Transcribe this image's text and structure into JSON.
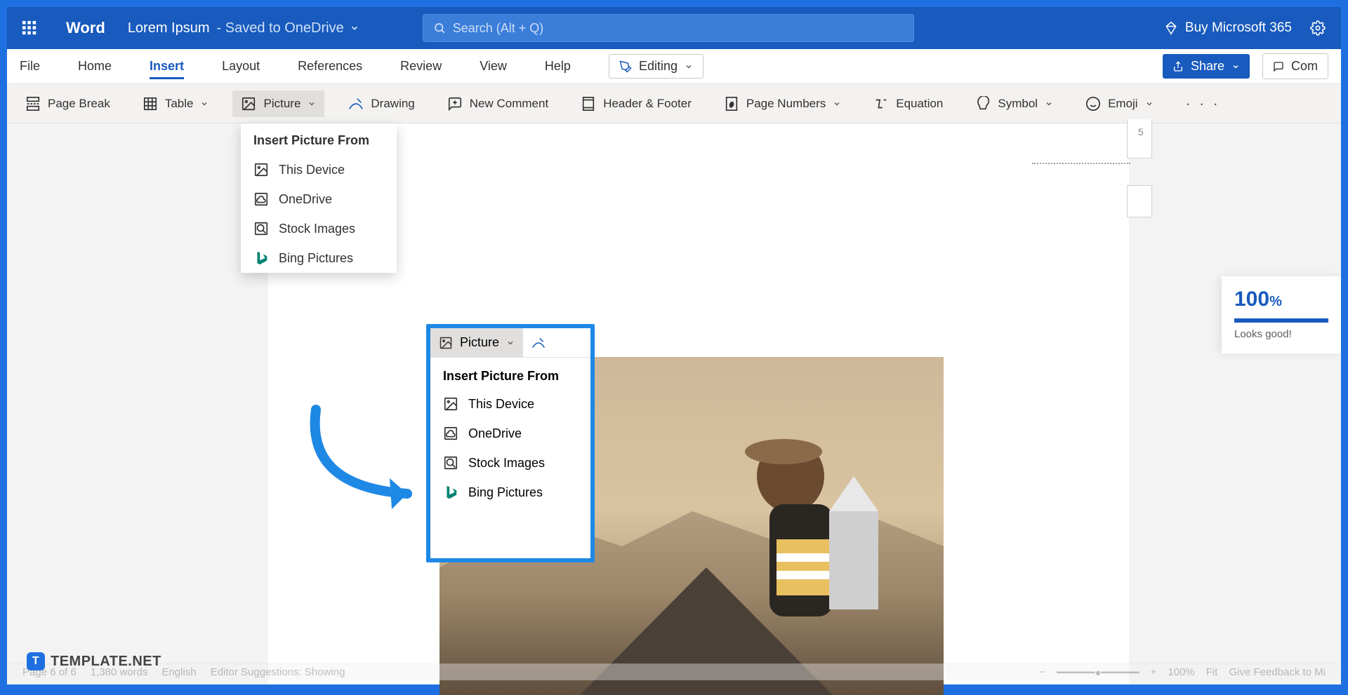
{
  "title": {
    "app": "Word",
    "doc": "Lorem Ipsum",
    "saved": "- Saved to OneDrive"
  },
  "search": {
    "placeholder": "Search (Alt + Q)"
  },
  "header_right": {
    "buy": "Buy Microsoft 365"
  },
  "tabs": {
    "file": "File",
    "home": "Home",
    "insert": "Insert",
    "layout": "Layout",
    "references": "References",
    "review": "Review",
    "view": "View",
    "help": "Help",
    "editing": "Editing",
    "share": "Share",
    "comments": "Com"
  },
  "ribbon": {
    "page_break": "Page Break",
    "table": "Table",
    "picture": "Picture",
    "drawing": "Drawing",
    "new_comment": "New Comment",
    "header_footer": "Header & Footer",
    "page_numbers": "Page Numbers",
    "equation": "Equation",
    "symbol": "Symbol",
    "emoji": "Emoji"
  },
  "picture_menu": {
    "header": "Insert Picture From",
    "items": {
      "device": "This Device",
      "onedrive": "OneDrive",
      "stock": "Stock Images",
      "bing": "Bing Pictures"
    }
  },
  "annot": {
    "picture": "Picture",
    "header": "Insert Picture From"
  },
  "ruler": {
    "five": "5"
  },
  "editor": {
    "score": "100",
    "pct": "%",
    "msg": "Looks good!"
  },
  "watermark": {
    "badge": "T",
    "text": "TEMPLATE.NET"
  },
  "status": {
    "page": "Page 6 of 6",
    "words": "1,380 words",
    "lang": "English",
    "sugg": "Editor Suggestions: Showing",
    "zoom": "100%",
    "fit": "Fit",
    "feedback": "Give Feedback to Mi"
  }
}
